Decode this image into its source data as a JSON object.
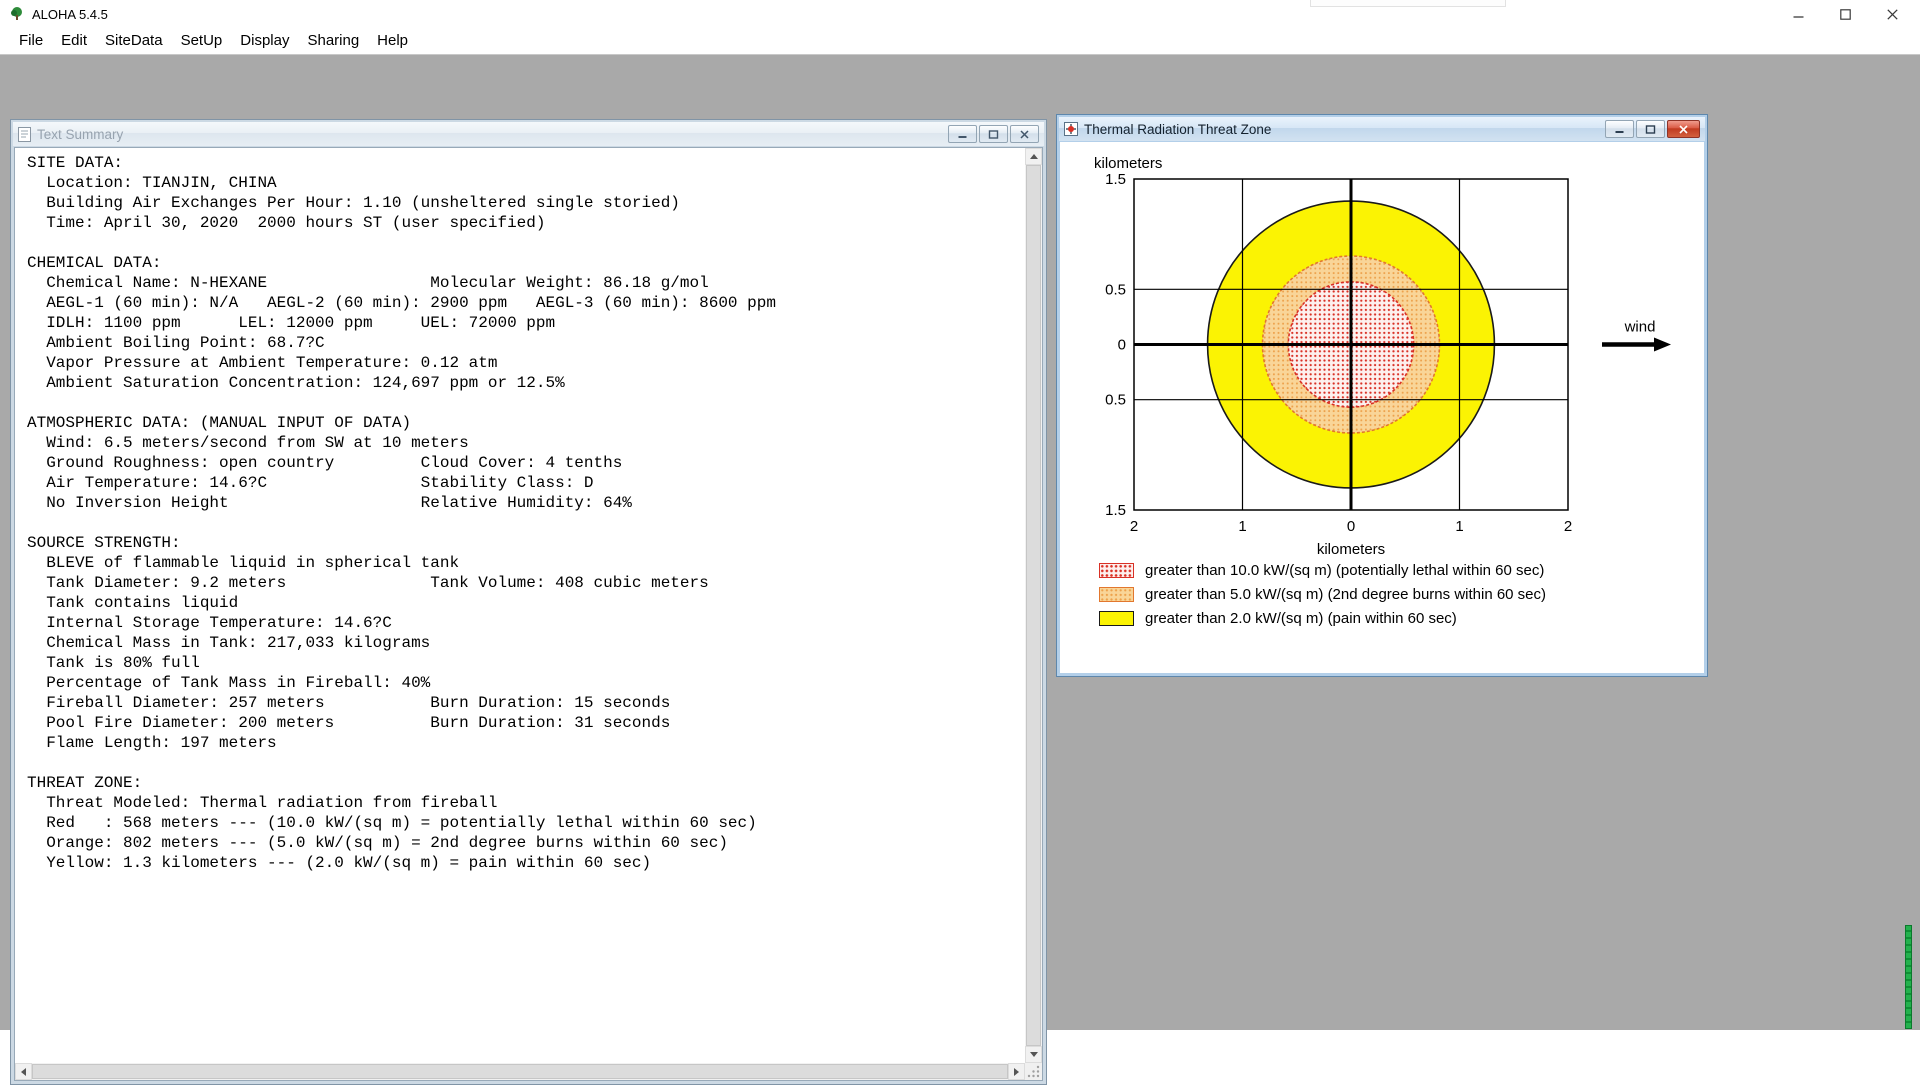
{
  "app": {
    "title": "ALOHA 5.4.5",
    "menu": [
      {
        "label": "File"
      },
      {
        "label": "Edit"
      },
      {
        "label": "SiteData"
      },
      {
        "label": "SetUp"
      },
      {
        "label": "Display"
      },
      {
        "label": "Sharing"
      },
      {
        "label": "Help"
      }
    ],
    "icons": {
      "app": "aloha-tree-icon",
      "window_controls": [
        "minimize-icon",
        "maximize-icon",
        "close-icon"
      ]
    }
  },
  "text_summary_window": {
    "title": "Text Summary",
    "content": "SITE DATA:\n  Location: TIANJIN, CHINA\n  Building Air Exchanges Per Hour: 1.10 (unsheltered single storied)\n  Time: April 30, 2020  2000 hours ST (user specified)\n\nCHEMICAL DATA:\n  Chemical Name: N-HEXANE                 Molecular Weight: 86.18 g/mol\n  AEGL-1 (60 min): N/A   AEGL-2 (60 min): 2900 ppm   AEGL-3 (60 min): 8600 ppm\n  IDLH: 1100 ppm      LEL: 12000 ppm     UEL: 72000 ppm\n  Ambient Boiling Point: 68.7?C\n  Vapor Pressure at Ambient Temperature: 0.12 atm\n  Ambient Saturation Concentration: 124,697 ppm or 12.5%\n\nATMOSPHERIC DATA: (MANUAL INPUT OF DATA)\n  Wind: 6.5 meters/second from SW at 10 meters\n  Ground Roughness: open country         Cloud Cover: 4 tenths\n  Air Temperature: 14.6?C                Stability Class: D\n  No Inversion Height                    Relative Humidity: 64%\n\nSOURCE STRENGTH:\n  BLEVE of flammable liquid in spherical tank\n  Tank Diameter: 9.2 meters               Tank Volume: 408 cubic meters\n  Tank contains liquid\n  Internal Storage Temperature: 14.6?C\n  Chemical Mass in Tank: 217,033 kilograms\n  Tank is 80% full\n  Percentage of Tank Mass in Fireball: 40%\n  Fireball Diameter: 257 meters           Burn Duration: 15 seconds\n  Pool Fire Diameter: 200 meters          Burn Duration: 31 seconds\n  Flame Length: 197 meters\n\nTHREAT ZONE:\n  Threat Modeled: Thermal radiation from fireball\n  Red   : 568 meters --- (10.0 kW/(sq m) = potentially lethal within 60 sec)\n  Orange: 802 meters --- (5.0 kW/(sq m) = 2nd degree burns within 60 sec)\n  Yellow: 1.3 kilometers --- (2.0 kW/(sq m) = pain within 60 sec)"
  },
  "threat_zone_window": {
    "title": "Thermal Radiation Threat Zone",
    "chart_data": {
      "type": "threat-zone-map",
      "title": "Thermal Radiation Threat Zone",
      "x_axis": {
        "label": "kilometers",
        "range_km": [
          -2,
          2
        ],
        "ticks": [
          {
            "v": -2,
            "label": "2"
          },
          {
            "v": -1,
            "label": "1"
          },
          {
            "v": 0,
            "label": "0"
          },
          {
            "v": 1,
            "label": "1"
          },
          {
            "v": 2,
            "label": "2"
          }
        ],
        "gridlines_km": [
          -1,
          0,
          1
        ]
      },
      "y_axis": {
        "label": "kilometers",
        "range_km": [
          -1.5,
          1.5
        ],
        "ticks": [
          {
            "v": 1.5,
            "label": "1.5"
          },
          {
            "v": 0.5,
            "label": "0.5"
          },
          {
            "v": 0,
            "label": "0"
          },
          {
            "v": -0.5,
            "label": "0.5"
          },
          {
            "v": -1.5,
            "label": "1.5"
          }
        ],
        "gridlines_km": [
          -0.5,
          0,
          0.5
        ]
      },
      "wind_label": "wind",
      "zones": [
        {
          "name": "red",
          "radius_km": 0.568,
          "threshold_kw_sqm": 10.0,
          "stroke": "#d93025",
          "label": "greater than 10.0 kW/(sq m) (potentially lethal within 60 sec)"
        },
        {
          "name": "orange",
          "radius_km": 0.802,
          "threshold_kw_sqm": 5.0,
          "stroke": "#e2772e",
          "label": "greater than 5.0 kW/(sq m) (2nd degree burns within 60 sec)"
        },
        {
          "name": "yellow",
          "radius_km": 1.3,
          "threshold_kw_sqm": 2.0,
          "stroke": "#1a1a1a",
          "label": "greater than 2.0 kW/(sq m) (pain within 60 sec)"
        }
      ],
      "legend_position": "bottom-left",
      "grid": true
    }
  },
  "colors": {
    "mdi_background": "#a9a9a9",
    "zone_yellow_fill": "#fbf303",
    "zone_orange_fill": "#f9d598",
    "zone_red_fill": "#fdf0ee",
    "close_button_red": "#c0391f"
  }
}
